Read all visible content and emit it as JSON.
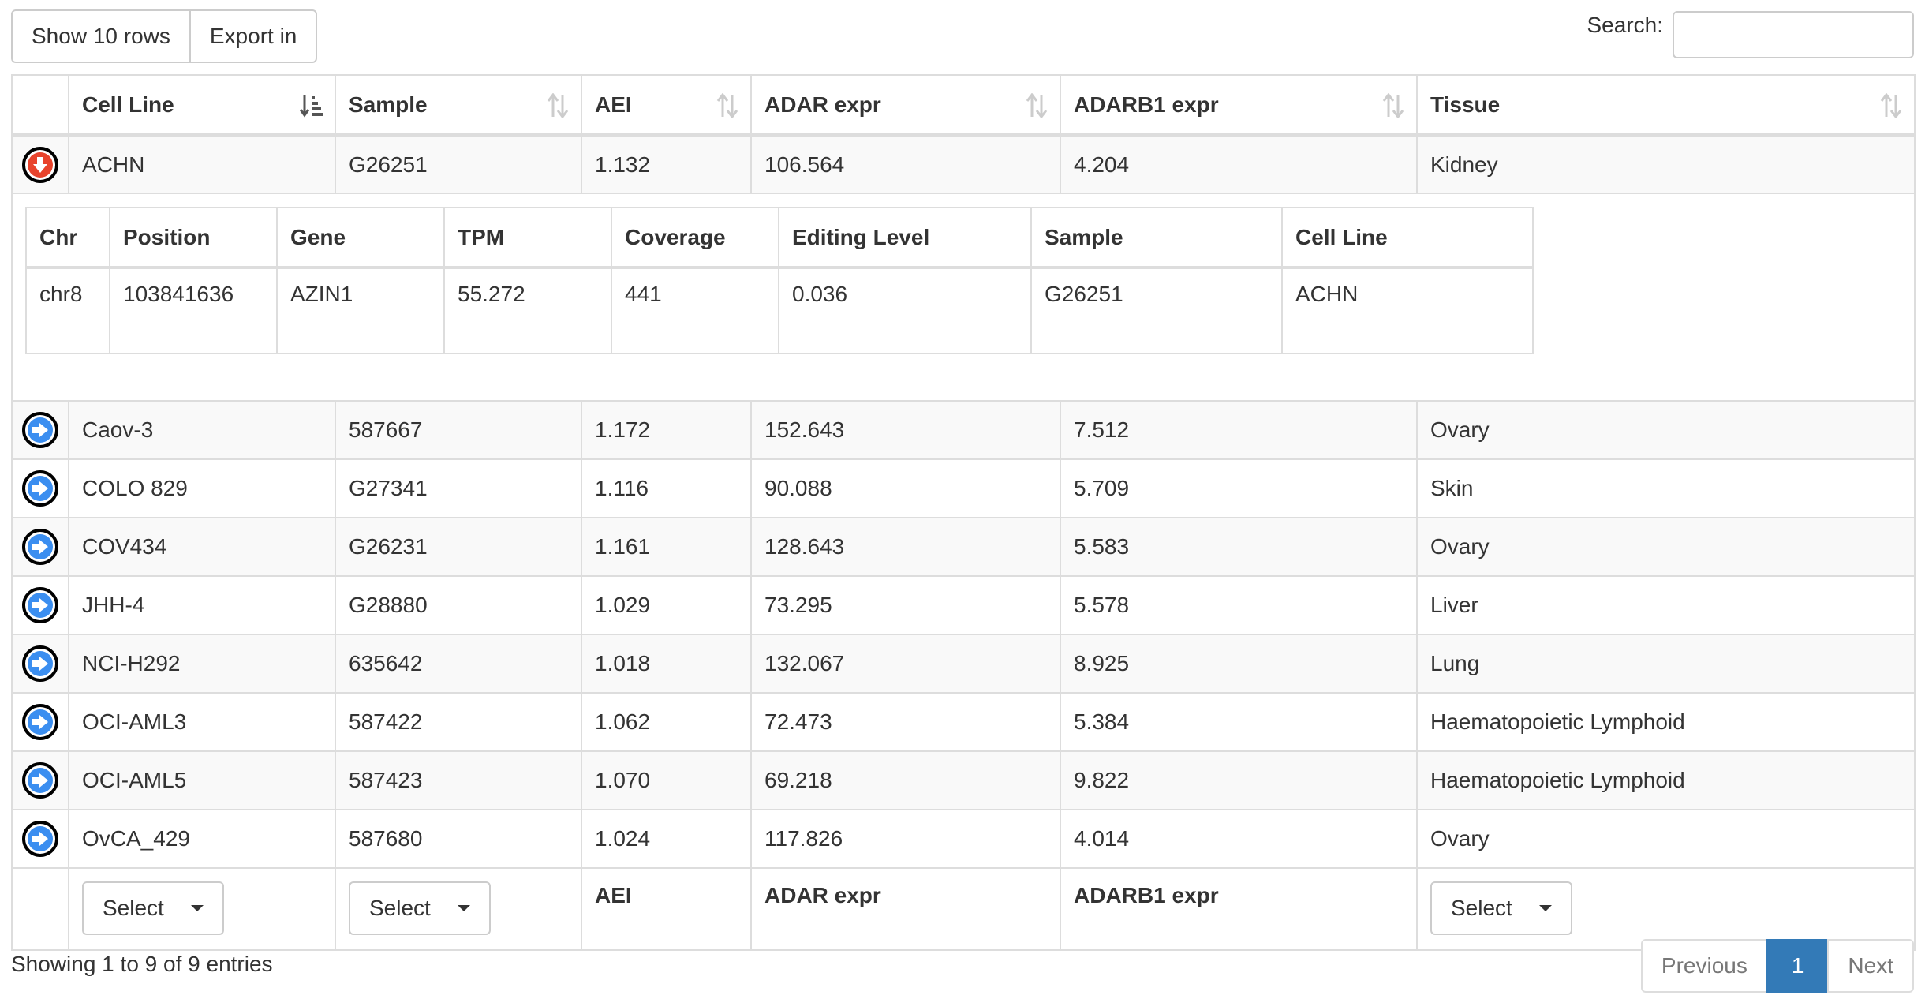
{
  "toolbar": {
    "show_rows_label": "Show 10 rows",
    "export_label": "Export in",
    "search_label": "Search:",
    "search_value": ""
  },
  "columns": [
    "Cell Line",
    "Sample",
    "AEI",
    "ADAR expr",
    "ADARB1 expr",
    "Tissue"
  ],
  "rows": [
    {
      "cell_line": "ACHN",
      "sample": "G26251",
      "aei": "1.132",
      "adar": "106.564",
      "adarb1": "4.204",
      "tissue": "Kidney",
      "expanded": true
    },
    {
      "cell_line": "Caov-3",
      "sample": "587667",
      "aei": "1.172",
      "adar": "152.643",
      "adarb1": "7.512",
      "tissue": "Ovary",
      "expanded": false
    },
    {
      "cell_line": "COLO 829",
      "sample": "G27341",
      "aei": "1.116",
      "adar": "90.088",
      "adarb1": "5.709",
      "tissue": "Skin",
      "expanded": false
    },
    {
      "cell_line": "COV434",
      "sample": "G26231",
      "aei": "1.161",
      "adar": "128.643",
      "adarb1": "5.583",
      "tissue": "Ovary",
      "expanded": false
    },
    {
      "cell_line": "JHH-4",
      "sample": "G28880",
      "aei": "1.029",
      "adar": "73.295",
      "adarb1": "5.578",
      "tissue": "Liver",
      "expanded": false
    },
    {
      "cell_line": "NCI-H292",
      "sample": "635642",
      "aei": "1.018",
      "adar": "132.067",
      "adarb1": "8.925",
      "tissue": "Lung",
      "expanded": false
    },
    {
      "cell_line": "OCI-AML3",
      "sample": "587422",
      "aei": "1.062",
      "adar": "72.473",
      "adarb1": "5.384",
      "tissue": "Haematopoietic Lymphoid",
      "expanded": false
    },
    {
      "cell_line": "OCI-AML5",
      "sample": "587423",
      "aei": "1.070",
      "adar": "69.218",
      "adarb1": "9.822",
      "tissue": "Haematopoietic Lymphoid",
      "expanded": false
    },
    {
      "cell_line": "OvCA_429",
      "sample": "587680",
      "aei": "1.024",
      "adar": "117.826",
      "adarb1": "4.014",
      "tissue": "Ovary",
      "expanded": false
    }
  ],
  "detail": {
    "columns": [
      "Chr",
      "Position",
      "Gene",
      "TPM",
      "Coverage",
      "Editing Level",
      "Sample",
      "Cell Line"
    ],
    "row": [
      "chr8",
      "103841636",
      "AZIN1",
      "55.272",
      "441",
      "0.036",
      "G26251",
      "ACHN"
    ]
  },
  "footer": {
    "select_label": "Select",
    "aei": "AEI",
    "adar": "ADAR expr",
    "adarb1": "ADARB1 expr"
  },
  "info_text": "Showing 1 to 9 of 9 entries",
  "pagination": {
    "previous": "Previous",
    "current": "1",
    "next": "Next"
  },
  "colors": {
    "accent": "#337ab7",
    "expand_open": "#e8432c",
    "expand_closed": "#3b8ef0"
  },
  "icons": {
    "expanded": "arrow-down-circle-icon",
    "collapsed": "arrow-right-circle-icon",
    "sort_active": "sort-amount-down-icon",
    "sort_both": "sort-both-icon"
  }
}
